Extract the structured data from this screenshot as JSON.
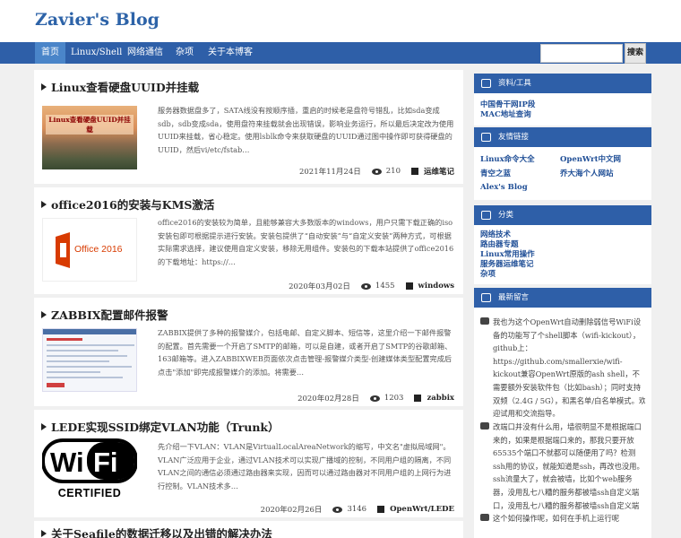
{
  "site": {
    "title": "Zavier's Blog"
  },
  "nav": {
    "items": [
      "首页",
      "Linux/Shell",
      "网络通信",
      "杂项",
      "关于本博客"
    ],
    "search_button": "搜索",
    "search_value": ""
  },
  "posts": [
    {
      "title": "Linux查看硬盘UUID并挂载",
      "thumb_caption": "Linux查看硬盘UUID并挂载",
      "excerpt": "服务器数据盘多了，SATA线没有按顺序插，重启的时候老是盘符号错乱，比如sda变成sdb，sdb变成sda，使用盘符来挂载就会出现错误，影响业务运行，所以最后决定改为使用UUID来挂载，省心稳定。使用lsblk命令来获取硬盘的UUID通过图中操作即可获得硬盘的UUID，然后vi/etc/fstab…",
      "date": "2021年11月24日",
      "views": "210",
      "category": "运维笔记"
    },
    {
      "title": "office2016的安装与KMS激活",
      "thumb_caption": "Office 2016",
      "excerpt": "office2016的安装较为简单，且能够兼容大多数版本的windows，用户只需下载正确的iso安装包即可根据提示进行安装。安装包提供了“自动安装”与“自定义安装”两种方式，可根据实际需求选择，建议使用自定义安装，移除无用组件。安装包的下载本站提供了office2016的下载地址：https://…",
      "date": "2020年03月02日",
      "views": "1455",
      "category": "windows"
    },
    {
      "title": "ZABBIX配置邮件报警",
      "excerpt": "ZABBIX提供了多种的报警媒介，包括电邮、自定义脚本、短信等，这里介绍一下邮件报警的配置。首先需要一个开启了SMTP的邮箱，可以是自建，或者开启了SMTP的谷歌邮箱、163邮箱等。进入ZABBIXWEB页面依次点击管理-报警媒介类型-创建媒体类型配置完成后点击\"添加\"即完成报警媒介的添加。将需要…",
      "date": "2020年02月28日",
      "views": "1203",
      "category": "zabbix"
    },
    {
      "title": "LEDE实现SSID绑定VLAN功能（Trunk）",
      "thumb_caption": "WiFi CERTIFIED",
      "excerpt": "先介绍一下VLAN：VLAN是VirtualLocalAreaNetwork的缩写，中文名\"虚拟局域网\"。VLAN广泛应用于企业，通过VLAN技术可以实现广播域的控制，不同用户组的隔离，不同VLAN之间的通信必须通过路由器来实现，因而可以通过路由器对不同用户组的上网行为进行控制。VLAN技术多…",
      "date": "2020年02月26日",
      "views": "3146",
      "category": "OpenWrt/LEDE"
    },
    {
      "title": "关于Seafile的数据迁移以及出错的解决办法"
    }
  ],
  "sidebar": {
    "resources": {
      "title": "资料/工具",
      "links": [
        "中国骨干网IP段",
        "MAC地址查询"
      ]
    },
    "friends": {
      "title": "友情链接",
      "links": [
        "Linux命令大全",
        "OpenWrt中文网",
        "青空之蓝",
        "乔大海个人网站",
        "Alex's Blog"
      ]
    },
    "categories": {
      "title": "分类",
      "links": [
        "网络技术",
        "路由器专题",
        "Linux常用操作",
        "服务器运维笔记",
        "杂项"
      ]
    },
    "comments": {
      "title": "最新留言",
      "items": [
        "我也为这个OpenWrt自动删除弱信号WiFi设备的功能写了个shell脚本（wifi-kickout），github上：https://github.com/smallerxie/wifi-kickout兼容OpenWrt原版的ash shell，不需要额外安装软件包（比如bash）；同时支持双频（2.4G / 5G），和黑名单/白名单模式。欢迎试用和交流指导。",
        "改端口并没有什么用，墙很明显不是根据端口来的，如果是根据端口来的，那我只要开放65535个端口不就都可以随便用了吗？检测ssh用的协议，就能知道是ssh，再改也没用。ssh流量大了，就会被墙，比如个web服务器，没用乱七八糟的服务都被墙ssh自定义端口，没用乱七八糟的服务都被墙ssh自定义端口，没服务都被墙。",
        "这个如何操作呢，如何在手机上运行呢"
      ]
    }
  }
}
